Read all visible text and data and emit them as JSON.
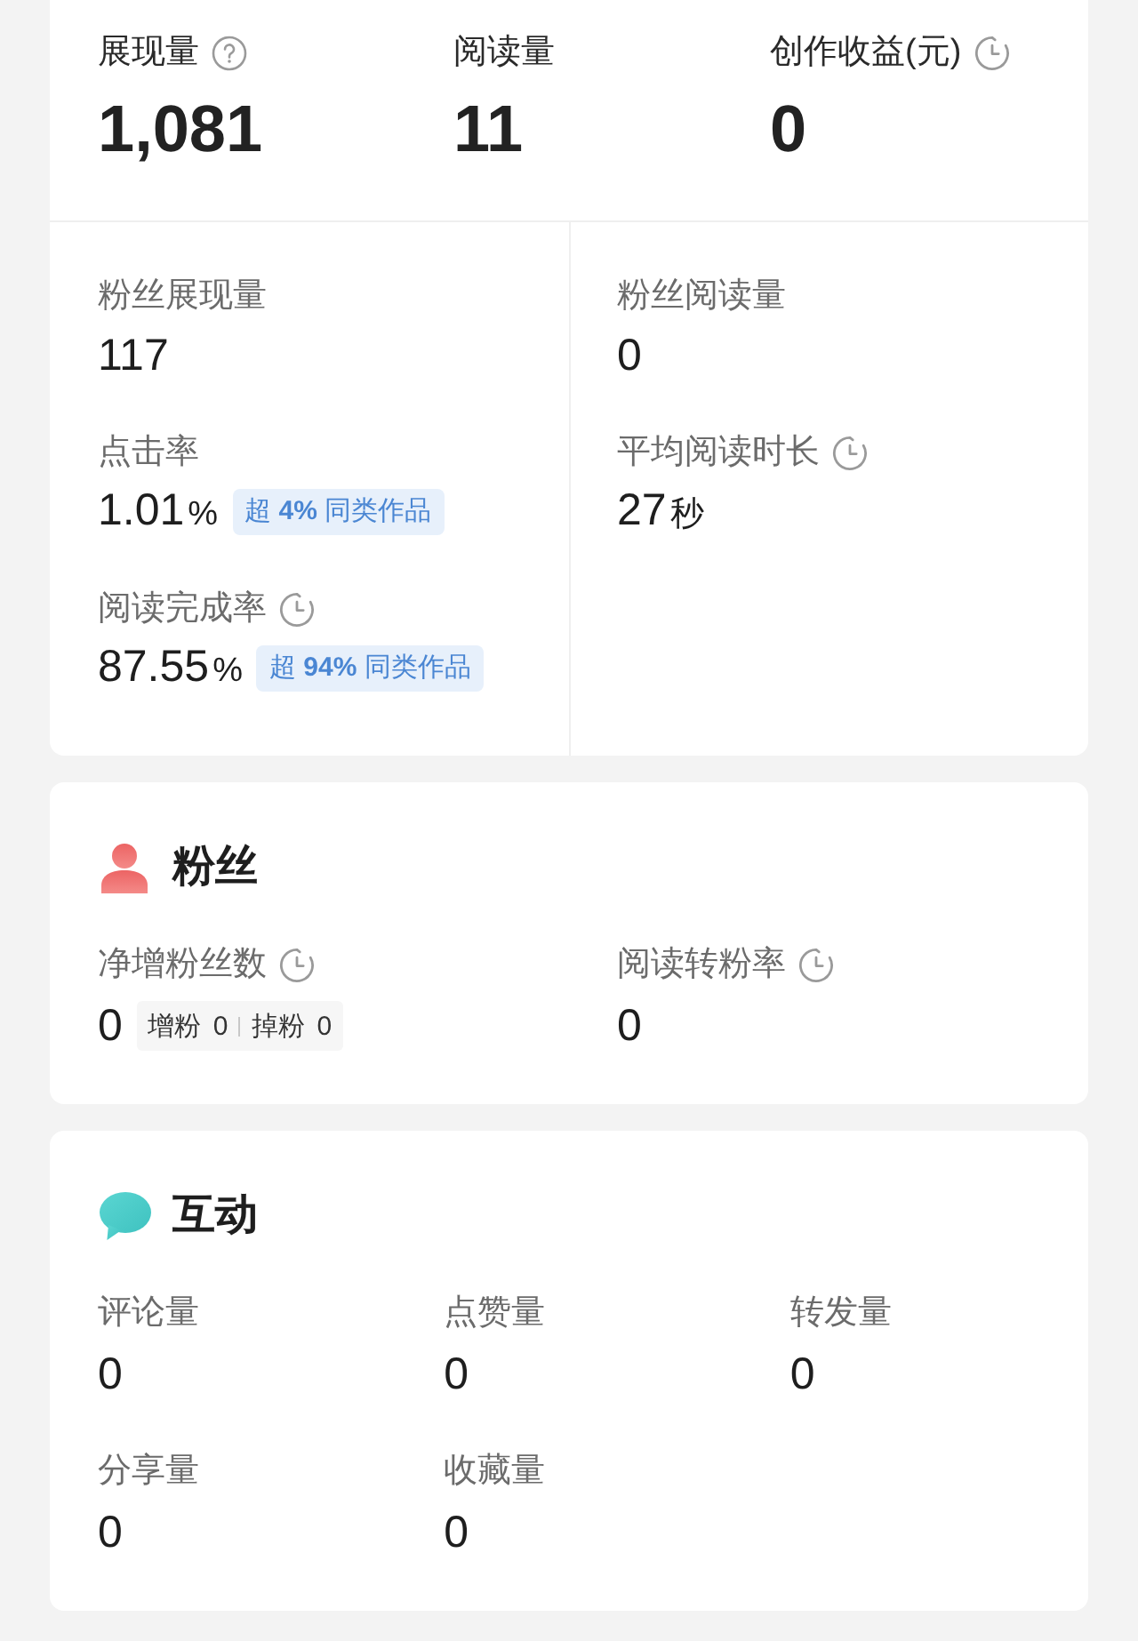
{
  "overview": {
    "metrics": [
      {
        "label": "展现量",
        "value": "1,081",
        "kind": "help"
      },
      {
        "label": "阅读量",
        "value": "11",
        "kind": "plain"
      },
      {
        "label": "创作收益(元)",
        "value": "0",
        "kind": "timed"
      }
    ],
    "details": [
      {
        "label": "粉丝展现量",
        "value": "117",
        "kind": "plain"
      },
      {
        "label": "粉丝阅读量",
        "value": "0",
        "kind": "plain"
      },
      {
        "label": "点击率",
        "value": "1.01",
        "unit": "%",
        "kind": "plain",
        "badge": "超 **4%** 同类作品"
      },
      {
        "label": "平均阅读时长",
        "value": "27",
        "unit": "秒",
        "kind": "timed"
      },
      {
        "label": "阅读完成率",
        "value": "87.55",
        "unit": "%",
        "kind": "timed",
        "badge": "超 **94%** 同类作品"
      }
    ]
  },
  "sections": [
    {
      "kind": "fans",
      "title": "粉丝",
      "metrics": [
        {
          "label": "净增粉丝数",
          "value": "0",
          "kind": "timed",
          "breakdown": [
            {
              "label": "增粉",
              "value": "0"
            },
            {
              "label": "掉粉",
              "value": "0"
            }
          ]
        },
        {
          "label": "阅读转粉率",
          "value": "0",
          "kind": "timed"
        }
      ]
    },
    {
      "kind": "engagement",
      "title": "互动",
      "metrics": [
        {
          "label": "评论量",
          "value": "0"
        },
        {
          "label": "点赞量",
          "value": "0"
        },
        {
          "label": "转发量",
          "value": "0"
        },
        {
          "label": "分享量",
          "value": "0"
        },
        {
          "label": "收藏量",
          "value": "0"
        }
      ]
    }
  ]
}
